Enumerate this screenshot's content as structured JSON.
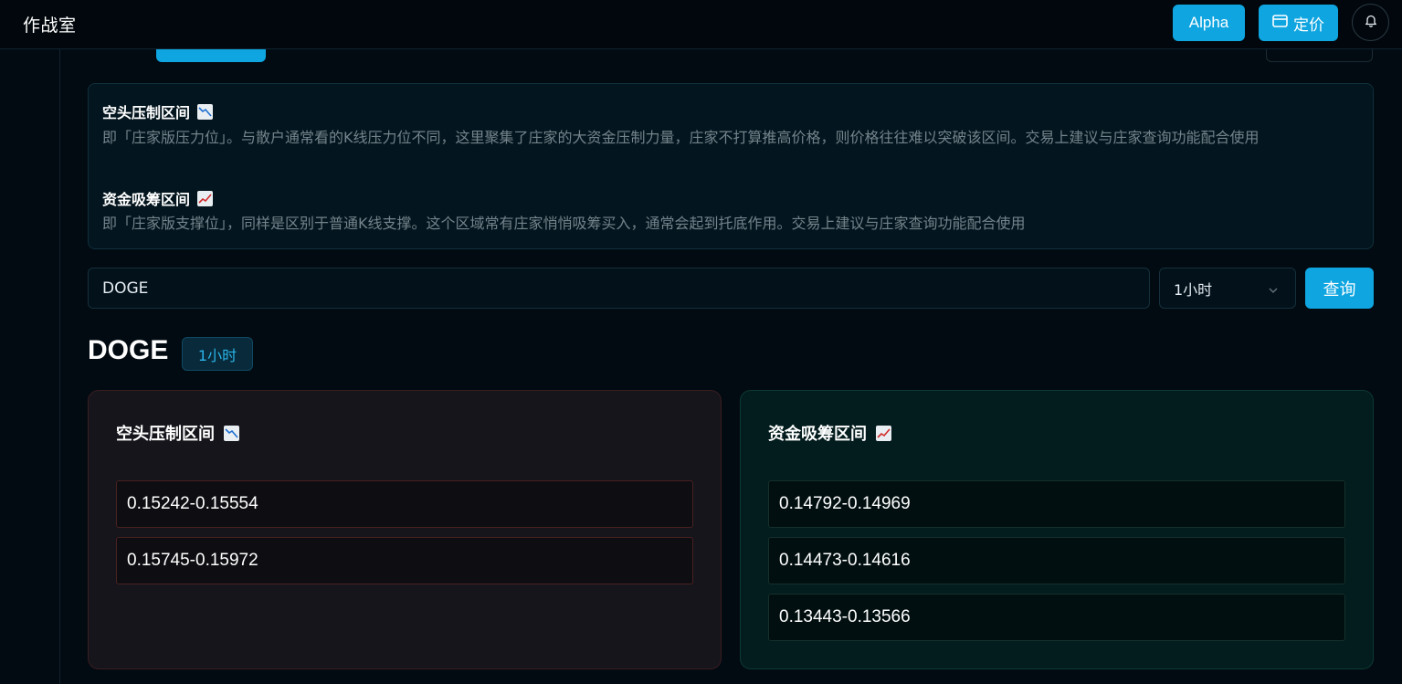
{
  "app": {
    "title": "作战室"
  },
  "topbar": {
    "alpha_label": "Alpha",
    "pricing_label": "定价"
  },
  "info": {
    "bear": {
      "title": "空头压制区间",
      "desc": "即「庄家版压力位」。与散户通常看的K线压力位不同，这里聚集了庄家的大资金压制力量，庄家不打算推高价格，则价格往往难以突破该区间。交易上建议与庄家查询功能配合使用"
    },
    "bull": {
      "title": "资金吸筹区间",
      "desc": "即「庄家版支撑位」，同样是区别于普通K线支撑。这个区域常有庄家悄悄吸筹买入，通常会起到托底作用。交易上建议与庄家查询功能配合使用"
    }
  },
  "search": {
    "value": "DOGE",
    "interval": "1小时",
    "query_label": "查询"
  },
  "result": {
    "symbol": "DOGE",
    "interval": "1小时",
    "bear_card": {
      "title": "空头压制区间",
      "zones": [
        "0.15242-0.15554",
        "0.15745-0.15972"
      ]
    },
    "bull_card": {
      "title": "资金吸筹区间",
      "zones": [
        "0.14792-0.14969",
        "0.14473-0.14616",
        "0.13443-0.13566"
      ]
    }
  },
  "colors": {
    "accent": "#0ea5e0",
    "bear_border": "#4a2121",
    "bull_border": "#14302d"
  }
}
